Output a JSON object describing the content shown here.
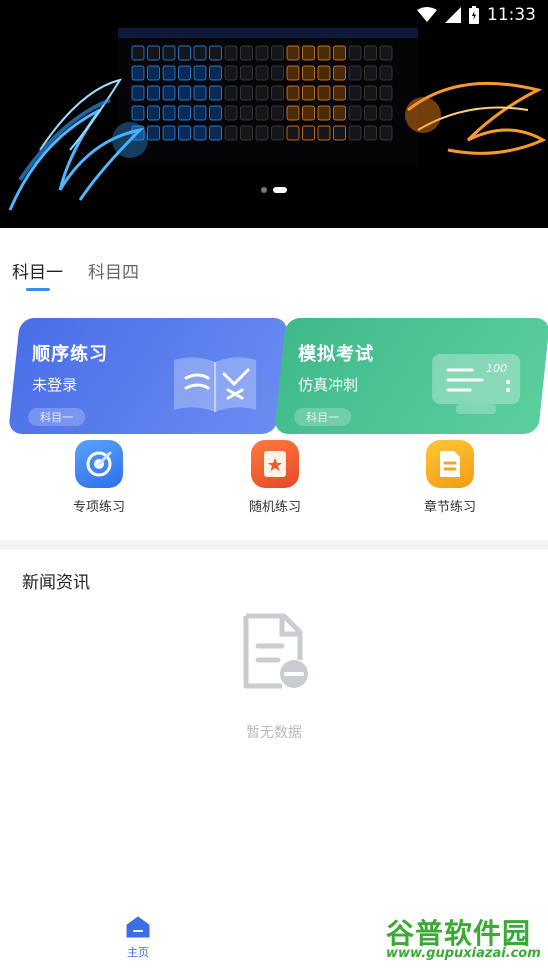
{
  "status_bar": {
    "time": "11:33"
  },
  "banner": {
    "slide_count": 2,
    "active_slide": 2
  },
  "tabs": [
    {
      "label": "科目一",
      "active": true
    },
    {
      "label": "科目四",
      "active": false
    }
  ],
  "cards": [
    {
      "title": "顺序练习",
      "subtitle": "未登录",
      "tag": "科目一",
      "color": "#4a6ee8"
    },
    {
      "title": "模拟考试",
      "subtitle": "仿真冲刺",
      "tag": "科目一",
      "color": "#3fb98a"
    }
  ],
  "quick_actions": [
    {
      "label": "专项练习",
      "icon": "target-icon",
      "color": "#3b82f6"
    },
    {
      "label": "随机练习",
      "icon": "random-card-icon",
      "color": "#f05a2a"
    },
    {
      "label": "章节练习",
      "icon": "document-icon",
      "color": "#f5a623"
    }
  ],
  "news": {
    "title": "新闻资讯",
    "empty_text": "暂无数据"
  },
  "bottom_nav": {
    "items": [
      {
        "label": "主页",
        "icon": "home-icon",
        "active": true
      }
    ]
  },
  "watermark": {
    "brand": "谷普软件园",
    "url": "www.gupuxiazai.com"
  }
}
